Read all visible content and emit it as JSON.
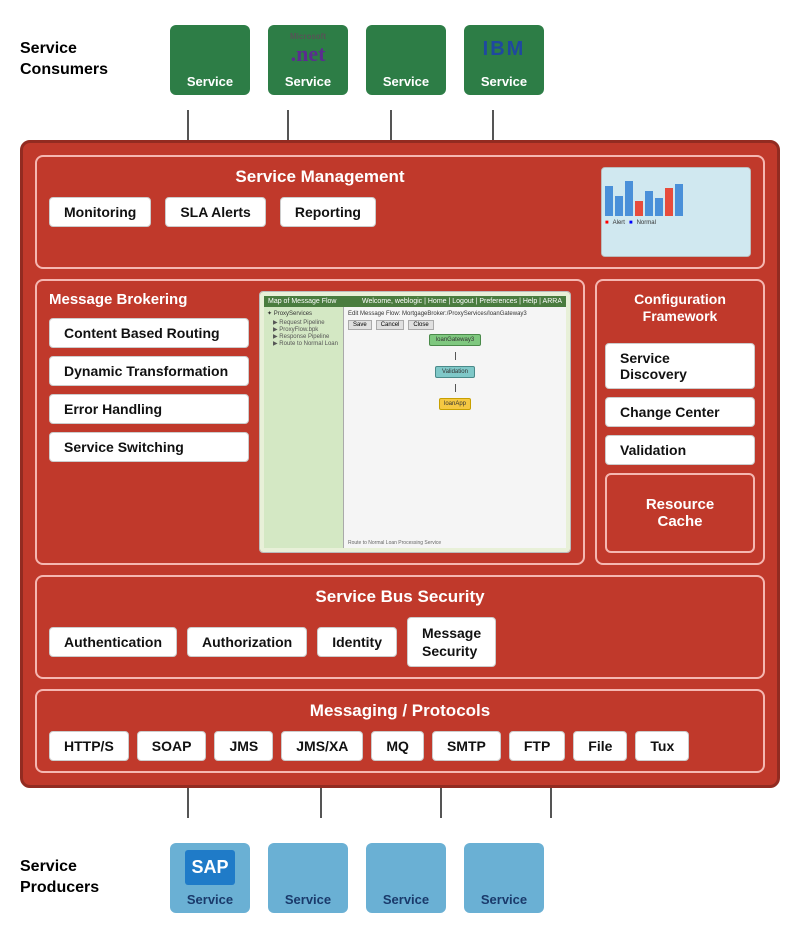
{
  "topSection": {
    "label": "Service\nConsumers",
    "services": [
      {
        "id": "svc1",
        "label": "Service",
        "type": "green",
        "logo": "plain"
      },
      {
        "id": "svc2",
        "label": "Service",
        "type": "green",
        "logo": "dotnet"
      },
      {
        "id": "svc3",
        "label": "Service",
        "type": "green",
        "logo": "plain"
      },
      {
        "id": "svc4",
        "label": "Service",
        "type": "green",
        "logo": "ibm"
      }
    ]
  },
  "mainPanel": {
    "serviceManagement": {
      "title": "Service Management",
      "items": [
        {
          "id": "monitoring",
          "label": "Monitoring"
        },
        {
          "id": "sla",
          "label": "SLA Alerts"
        },
        {
          "id": "reporting",
          "label": "Reporting"
        }
      ]
    },
    "messageBrokering": {
      "title": "Message Brokering",
      "items": [
        {
          "id": "cbr",
          "label": "Content Based Routing"
        },
        {
          "id": "dt",
          "label": "Dynamic Transformation"
        },
        {
          "id": "eh",
          "label": "Error Handling"
        },
        {
          "id": "ss",
          "label": "Service Switching"
        }
      ]
    },
    "configFramework": {
      "title": "Configuration\nFramework",
      "items": [
        {
          "id": "sd",
          "label": "Service Discovery"
        },
        {
          "id": "cc",
          "label": "Change Center"
        },
        {
          "id": "val",
          "label": "Validation"
        }
      ],
      "resourceCache": "Resource\nCache"
    },
    "serviceBusSecurity": {
      "title": "Service Bus Security",
      "items": [
        {
          "id": "auth",
          "label": "Authentication"
        },
        {
          "id": "authz",
          "label": "Authorization"
        },
        {
          "id": "identity",
          "label": "Identity"
        },
        {
          "id": "msgsec",
          "label": "Message\nSecurity"
        }
      ]
    },
    "messagingProtocols": {
      "title": "Messaging / Protocols",
      "items": [
        {
          "id": "https",
          "label": "HTTP/S"
        },
        {
          "id": "soap",
          "label": "SOAP"
        },
        {
          "id": "jms",
          "label": "JMS"
        },
        {
          "id": "jmsxa",
          "label": "JMS/XA"
        },
        {
          "id": "mq",
          "label": "MQ"
        },
        {
          "id": "smtp",
          "label": "SMTP"
        },
        {
          "id": "ftp",
          "label": "FTP"
        },
        {
          "id": "file",
          "label": "File"
        },
        {
          "id": "tux",
          "label": "Tux"
        }
      ]
    }
  },
  "bottomSection": {
    "label": "Service\nProducers",
    "services": [
      {
        "id": "bsvc1",
        "label": "Service",
        "type": "blue",
        "logo": "sap"
      },
      {
        "id": "bsvc2",
        "label": "Service",
        "type": "blue",
        "logo": "plain"
      },
      {
        "id": "bsvc3",
        "label": "Service",
        "type": "blue",
        "logo": "plain"
      },
      {
        "id": "bsvc4",
        "label": "Service",
        "type": "blue",
        "logo": "plain"
      }
    ]
  },
  "colors": {
    "darkRed": "#c0392b",
    "medRed": "#a93226",
    "borderRed": "#f5b7b1",
    "green": "#2d7d46",
    "blue": "#6ab0d4"
  }
}
